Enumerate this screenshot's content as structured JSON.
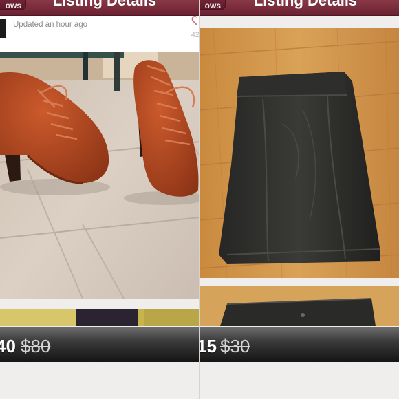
{
  "listings": [
    {
      "nav": {
        "back_label": "ows",
        "title": "Listing Details"
      },
      "meta": {
        "updated": "Updated an hour ago",
        "like_count": "42"
      },
      "photo_subject": "rust-colored suede lace-up platform ankle booties",
      "price": "40",
      "original_price": "$80"
    },
    {
      "nav": {
        "back_label": "ows",
        "title": "Listing Details"
      },
      "photo_subject": "black leather pencil skirt on wood floor",
      "price": "15",
      "original_price": "$30"
    }
  ],
  "colors": {
    "navbar": "#7a2d3c",
    "price_bar": "#2b2b2b",
    "background": "#efeeec"
  }
}
